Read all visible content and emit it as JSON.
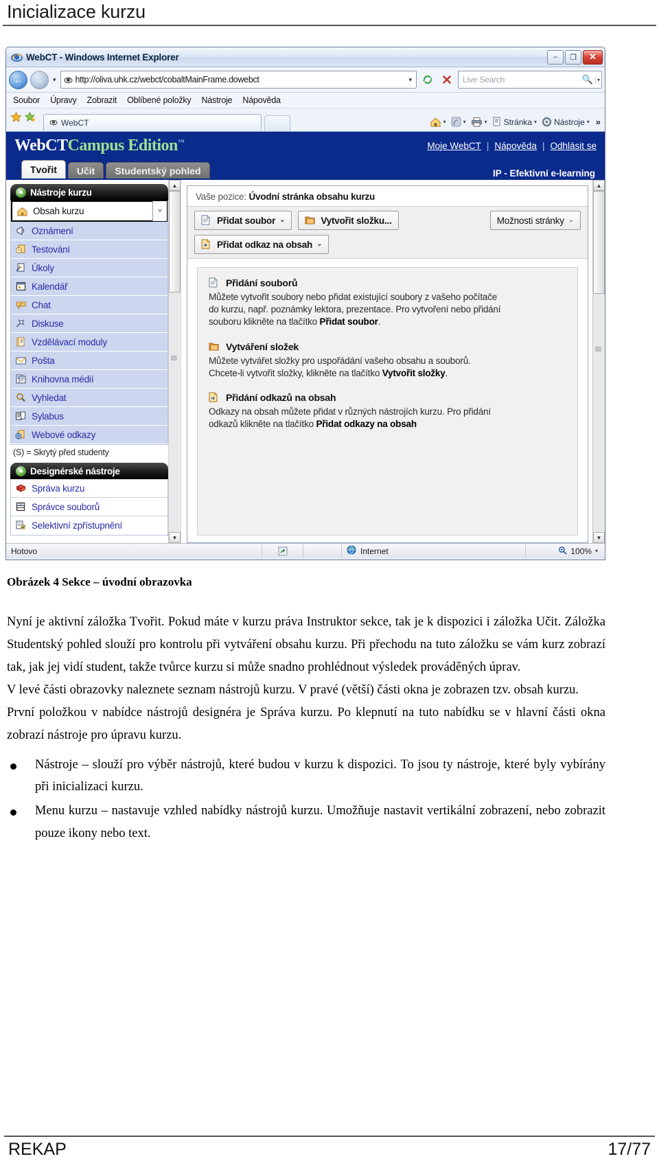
{
  "document": {
    "header_title": "Inicializace kurzu",
    "figure_caption": "Obrázek 4 Sekce – úvodní obrazovka",
    "paragraphs": [
      "Nyní je aktivní záložka Tvořit. Pokud máte v kurzu práva Instruktor sekce, tak je k dispozici i záložka Učit. Záložka Studentský pohled slouží pro kontrolu při vytváření obsahu kurzu. Při přechodu na tuto záložku se vám kurz zobrazí tak, jak jej vidí student, takže tvůrce kurzu si může snadno prohlédnout výsledek prováděných úprav.",
      "V levé části obrazovky naleznete seznam nástrojů kurzu. V pravé (větší) části okna je zobrazen tzv. obsah kurzu.",
      "První položkou v nabídce nástrojů designéra je Správa kurzu. Po klepnutí na tuto nabídku se v hlavní části okna zobrazí nástroje pro úpravu kurzu."
    ],
    "bullets": [
      "Nástroje – slouží pro výběr nástrojů, které budou v kurzu k dispozici. To jsou ty nástroje, které byly vybírány při inicializaci kurzu.",
      "Menu kurzu – nastavuje vzhled nabídky nástrojů kurzu. Umožňuje nastavit vertikální zobrazení, nebo zobrazit pouze ikony nebo text."
    ],
    "footer_left": "REKAP",
    "footer_right": "17/77"
  },
  "browser": {
    "title": "WebCT - Windows Internet Explorer",
    "window_buttons": {
      "minimize": "–",
      "maximize": "❐",
      "close": "✕"
    },
    "address": {
      "url": "http://oliva.uhk.cz/webct/cobaltMainFrame.dowebct",
      "dropdown_caret": "▾",
      "refresh_label": "refresh",
      "stop_label": "stop"
    },
    "search": {
      "placeholder": "Live Search",
      "caret": "▾"
    },
    "menu": [
      "Soubor",
      "Úpravy",
      "Zobrazit",
      "Oblíbené položky",
      "Nástroje",
      "Nápověda"
    ],
    "tab_label": "WebCT",
    "command_bar": [
      "Stránka",
      "Nástroje"
    ],
    "command_overflow": "»",
    "status": {
      "message": "Hotovo",
      "zone": "Internet",
      "zoom": "100%",
      "zoom_caret": "▾"
    }
  },
  "webct": {
    "brand_part1": "WebCT",
    "brand_part2": "Campus Edition",
    "brand_tm": "™",
    "top_links": [
      "Moje WebCT",
      "Nápověda",
      "Odhlásit se"
    ],
    "link_separator": "|",
    "tabs": [
      {
        "label": "Tvořit",
        "active": true
      },
      {
        "label": "Učit",
        "active": false
      },
      {
        "label": "Studentský pohled",
        "active": false
      }
    ],
    "course_label": "IP - Efektivní e-learning",
    "sidebar": {
      "section1_title": "Nástroje kurzu",
      "items": [
        {
          "label": "Obsah kurzu",
          "icon": "home-icon",
          "selected": true
        },
        {
          "label": "Oznámení",
          "icon": "announcement-icon",
          "selected": false
        },
        {
          "label": "Testování",
          "icon": "quiz-icon",
          "selected": false
        },
        {
          "label": "Úkoly",
          "icon": "assignment-icon",
          "selected": false
        },
        {
          "label": "Kalendář",
          "icon": "calendar-icon",
          "selected": false
        },
        {
          "label": "Chat",
          "icon": "chat-icon",
          "selected": false
        },
        {
          "label": "Diskuse",
          "icon": "discussion-icon",
          "selected": false
        },
        {
          "label": "Vzdělávací moduly",
          "icon": "module-icon",
          "selected": false
        },
        {
          "label": "Pošta",
          "icon": "mail-icon",
          "selected": false
        },
        {
          "label": "Knihovna médií",
          "icon": "media-library-icon",
          "selected": false
        },
        {
          "label": "Vyhledat",
          "icon": "search-icon",
          "selected": false
        },
        {
          "label": "Sylabus",
          "icon": "syllabus-icon",
          "selected": false
        },
        {
          "label": "Webové odkazy",
          "icon": "weblink-icon",
          "selected": false
        }
      ],
      "legend": "(S) = Skrytý před studenty",
      "section2_title": "Designérské nástroje",
      "designer_items": [
        {
          "label": "Správa kurzu",
          "icon": "course-admin-icon"
        },
        {
          "label": "Správce souborů",
          "icon": "file-manager-icon"
        },
        {
          "label": "Selektivní zpřístupnění",
          "icon": "selective-release-icon"
        }
      ],
      "expand_caret": "˅"
    },
    "content": {
      "breadcrumb_label": "Vaše pozice:",
      "breadcrumb_current": "Úvodní stránka obsahu kurzu",
      "buttons": [
        {
          "label": "Přidat soubor",
          "icon": "file-icon",
          "has_caret": true,
          "bold": true
        },
        {
          "label": "Vytvořit složku...",
          "icon": "folder-icon",
          "has_caret": false,
          "bold": true
        },
        {
          "label": "Možnosti stránky",
          "icon": "",
          "has_caret": true,
          "bold": false
        },
        {
          "label": "Přidat odkaz na obsah",
          "icon": "link-file-icon",
          "has_caret": true,
          "bold": true
        }
      ],
      "help_blocks": [
        {
          "icon": "file-icon",
          "title": "Přidání souborů",
          "text_before": "Můžete vytvořit soubory nebo přidat existující soubory z vašeho počítače do kurzu, např. poznámky lektora, prezentace. Pro vytvoření nebo přidání souboru klikněte na tlačítko ",
          "text_bold": "Přidat soubor",
          "text_after": "."
        },
        {
          "icon": "folder-icon",
          "title": "Vytváření složek",
          "text_before": "Můžete vytvářet složky pro uspořádání vašeho obsahu a souborů. Chcete-li vytvořit složky, klikněte na tlačítko ",
          "text_bold": "Vytvořit složky",
          "text_after": "."
        },
        {
          "icon": "link-file-icon",
          "title": "Přidání odkazů na obsah",
          "text_before": "Odkazy na obsah můžete přidat v různých nástrojích kurzu. Pro přidání odkazů klikněte na tlačítko ",
          "text_bold": "Přidat odkazy na obsah",
          "text_after": ""
        }
      ]
    }
  },
  "colors": {
    "webct_blue": "#0a2a8c",
    "link_blue": "#2a2aa8",
    "accent_green": "#9fe08f",
    "panel_gray": "#f1f1f1"
  }
}
